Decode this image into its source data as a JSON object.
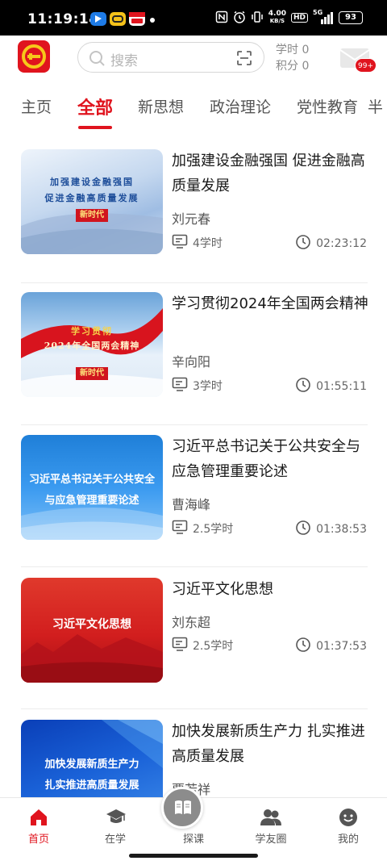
{
  "status_bar": {
    "time": "11:19:14",
    "net_speed_value": "4.00",
    "net_speed_unit": "KB/S",
    "hd": "HD",
    "signal": "5G",
    "battery": "93"
  },
  "header": {
    "search_placeholder": "搜索",
    "study_hours": "学时 0",
    "points": "积分 0",
    "mail_badge": "99+"
  },
  "tabs": [
    {
      "label": "主页"
    },
    {
      "label": "全部"
    },
    {
      "label": "新思想"
    },
    {
      "label": "政治理论"
    },
    {
      "label": "党性教育"
    },
    {
      "label": "半"
    }
  ],
  "courses": [
    {
      "title": "加强建设金融强国 促进金融高质量发展",
      "author": "刘元春",
      "hours": "4学时",
      "duration": "02:23:12",
      "thumb_line1": "加强建设金融强国",
      "thumb_line2": "促进金融高质量发展",
      "thumb_stamp": "新时代"
    },
    {
      "title": "学习贯彻2024年全国两会精神",
      "author": "辛向阳",
      "hours": "3学时",
      "duration": "01:55:11",
      "thumb_line1": "学习贯彻",
      "thumb_line2": "2024年全国两会精神",
      "thumb_stamp": "新时代"
    },
    {
      "title": "习近平总书记关于公共安全与应急管理重要论述",
      "author": "曹海峰",
      "hours": "2.5学时",
      "duration": "01:38:53",
      "thumb_line1": "习近平总书记关于公共安全",
      "thumb_line2": "与应急管理重要论述"
    },
    {
      "title": "习近平文化思想",
      "author": "刘东超",
      "hours": "2.5学时",
      "duration": "01:37:53",
      "thumb_line1": "习近平文化思想"
    },
    {
      "title": "加快发展新质生产力 扎实推进高质量发展",
      "author": "贾若祥",
      "thumb_line1": "加快发展新质生产力",
      "thumb_line2": "扎实推进高质量发展"
    }
  ],
  "bottom_nav": [
    {
      "label": "首页",
      "icon": "home-icon"
    },
    {
      "label": "在学",
      "icon": "graduation-cap-icon"
    },
    {
      "label": "探课",
      "icon": "open-book-icon"
    },
    {
      "label": "学友圈",
      "icon": "people-icon"
    },
    {
      "label": "我的",
      "icon": "smile-face-icon"
    }
  ],
  "colors": {
    "accent": "#e0141e",
    "text": "#1a1a1a",
    "muted": "#666666"
  }
}
